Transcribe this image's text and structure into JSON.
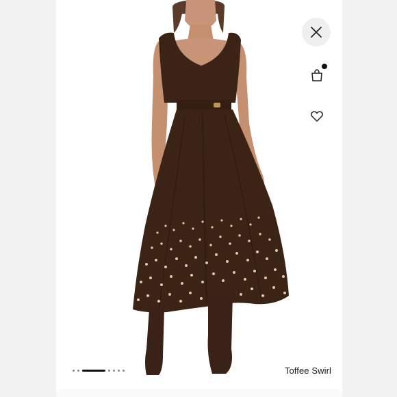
{
  "product": {
    "color_name": "Toffee Swirl"
  },
  "carousel": {
    "total": 7,
    "active_index": 2
  },
  "actions": {
    "close_icon": "close-icon",
    "bag_icon": "shopping-bag-icon",
    "wishlist_icon": "heart-icon"
  },
  "colors": {
    "dress": "#3b2315",
    "boots": "#3a2218",
    "skin": "#c89478",
    "hair": "#5a3a28",
    "stud": "#d9c9a8"
  }
}
